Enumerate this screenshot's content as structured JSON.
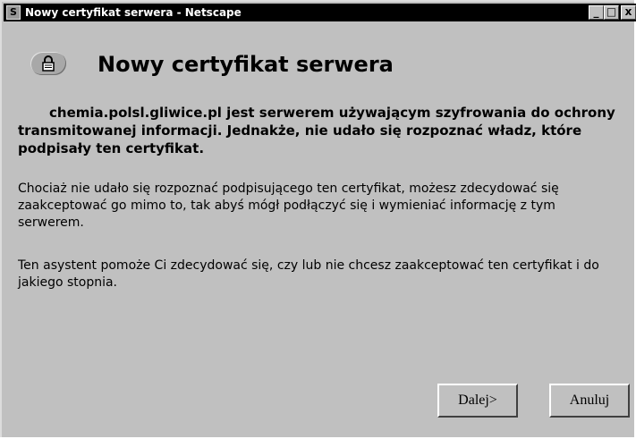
{
  "window": {
    "title": "Nowy certyfikat serwera - Netscape",
    "app_icon_glyph": "S",
    "controls": {
      "minimize": "_",
      "maximize": "□",
      "close": "x"
    }
  },
  "dialog": {
    "heading": "Nowy certyfikat serwera",
    "header_icon": "lock-icon",
    "intro": "chemia.polsl.gliwice.pl jest serwerem używającym szyfrowania do ochrony transmitowanej informacji. Jednakże, nie udało się rozpoznać władz, które podpisały ten certyfikat.",
    "paragraph1": "Chociaż nie udało się rozpoznać podpisującego ten certyfikat, możesz zdecydować się zaakceptować go mimo to, tak abyś mógł podłączyć się i wymieniać informację z tym serwerem.",
    "paragraph2": "Ten asystent pomoże Ci zdecydować się, czy lub nie chcesz zaakceptować ten certyfikat i do jakiego stopnia."
  },
  "buttons": {
    "next": "Dalej>",
    "cancel": "Anuluj"
  }
}
